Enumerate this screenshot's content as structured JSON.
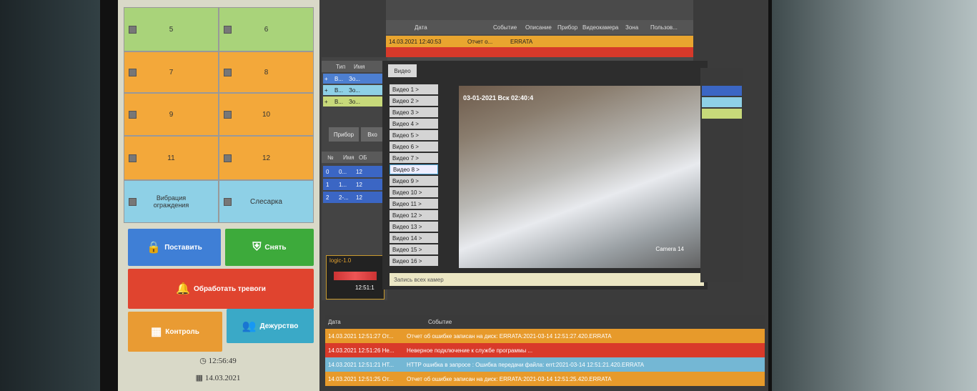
{
  "grid": {
    "cells": [
      {
        "label": "5",
        "color": "green"
      },
      {
        "label": "6",
        "color": "green"
      },
      {
        "label": "7",
        "color": "orange"
      },
      {
        "label": "8",
        "color": "orange"
      },
      {
        "label": "9",
        "color": "orange"
      },
      {
        "label": "10",
        "color": "orange"
      },
      {
        "label": "11",
        "color": "orange"
      },
      {
        "label": "12",
        "color": "orange"
      },
      {
        "label": "Вибрация ограждения",
        "color": "blue"
      },
      {
        "label": "Слесарка",
        "color": "blue"
      }
    ],
    "arm_button": "Поставить",
    "disarm_button": "Снять",
    "alarm_button": "Обработать тревоги",
    "control_button": "Контроль",
    "duty_button": "Дежурство",
    "time": "12:56:49",
    "date": "14.03.2021"
  },
  "top_events": {
    "columns": [
      "Дата",
      "Событие",
      "Описание",
      "Прибор",
      "Видеокамера",
      "Зона",
      "Пользов..."
    ],
    "row_date": "14.03.2021 12:40:53",
    "row_event": "Отчет о...",
    "row_desc": "ERRATA"
  },
  "left_table": {
    "cols": [
      "Тип",
      "Имя"
    ],
    "rows": [
      [
        "+",
        "В...",
        "Зо..."
      ],
      [
        "+",
        "В...",
        "Зо..."
      ],
      [
        "+",
        "В...",
        "Зо..."
      ]
    ],
    "tabs": [
      "Прибор",
      "Вхо"
    ],
    "cols2": [
      "№",
      "Имя",
      "ОБ"
    ],
    "rows2": [
      [
        "0",
        "0...",
        "12"
      ],
      [
        "1",
        "1...",
        "12"
      ],
      [
        "2",
        "2-...",
        "12"
      ]
    ]
  },
  "video": {
    "tab": "Видео",
    "items": [
      "Видео 1 >",
      "Видео 2 >",
      "Видео 3 >",
      "Видео 4 >",
      "Видео 5 >",
      "Видео 6 >",
      "Видео 7 >",
      "Видео 8 >",
      "Видео 9 >",
      "Видео 10 >",
      "Видео 11 >",
      "Видео 12 >",
      "Видео 13 >",
      "Видео 14 >",
      "Видео 15 >",
      "Видео 16 >"
    ],
    "selected_index": 7,
    "timestamp": "03-01-2021 Вск 02:40:4",
    "camera_label": "Camera 14",
    "status": "Запись всех камер"
  },
  "mini_widget": {
    "title": "logic-1.0",
    "time": "12:51:1"
  },
  "bottom_events": {
    "col_date": "Дата",
    "col_event": "Событие",
    "rows": [
      {
        "date": "14.03.2021 12:51:27 От...",
        "text": "Отчет об ошибке записан на диск: ERRATA:2021-03-14 12:51:27.420.ERRATA",
        "color": "#e79a2b"
      },
      {
        "date": "14.03.2021 12:51:26 Не...",
        "text": "Неверное подключение к службе программы ...",
        "color": "#d93a2a"
      },
      {
        "date": "14.03.2021 12:51:21 НТ...",
        "text": "HTTP ошибка в запросе : Ошибка передачи файла: errt:2021-03-14 12:51:21.420.ERRATA",
        "color": "#74b7d4"
      },
      {
        "date": "14.03.2021 12:51:25 От...",
        "text": "Отчет об ошибке записан на диск: ERRATA:2021-03-14 12:51:25.420.ERRATA",
        "color": "#e79a2b"
      }
    ]
  }
}
